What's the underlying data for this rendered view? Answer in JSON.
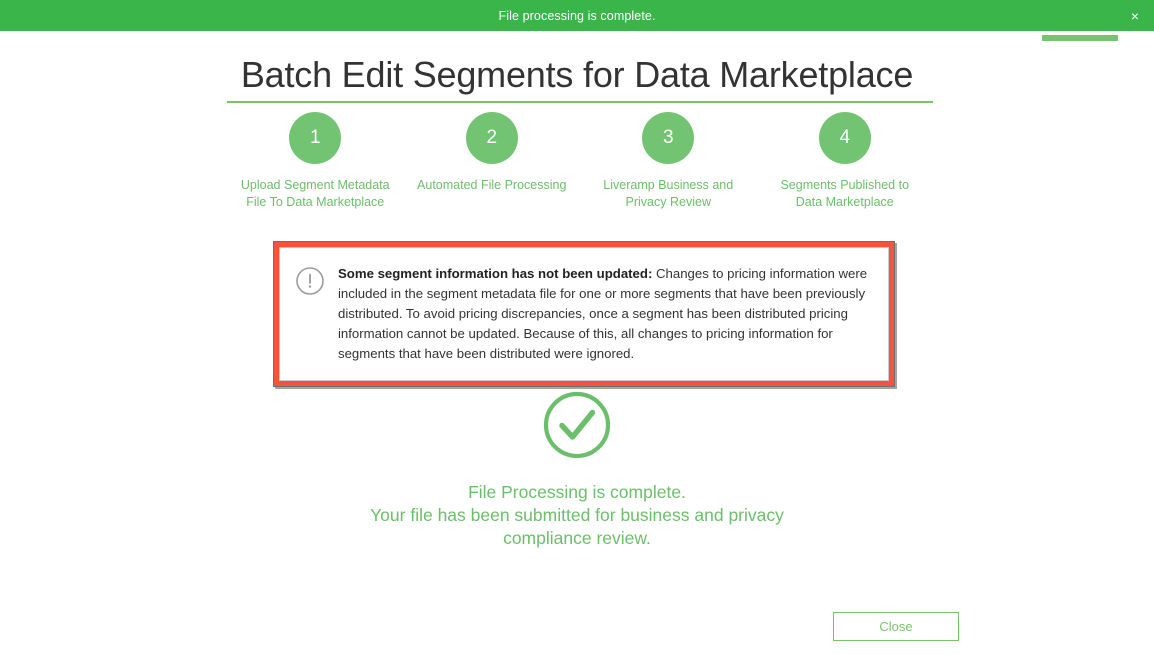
{
  "banner": {
    "message": "File processing is complete.",
    "close_icon": "close-icon",
    "close_label": "×",
    "background": "#39b54a"
  },
  "mini_progress": {
    "value": 100,
    "color": "#74c572"
  },
  "page": {
    "title": "Batch Edit Segments for Data Marketplace",
    "accent_color": "#7ac36c"
  },
  "stepper": {
    "steps": [
      {
        "number": "1",
        "label": "Upload Segment Metadata File To Data Marketplace"
      },
      {
        "number": "2",
        "label": "Automated File Processing"
      },
      {
        "number": "3",
        "label": "Liveramp Business and Privacy Review"
      },
      {
        "number": "4",
        "label": "Segments Published to Data Marketplace"
      }
    ]
  },
  "alert": {
    "icon": "exclamation-circle-icon",
    "border_color": "#f4543c",
    "title": "Some segment information has not been updated:",
    "message": " Changes to pricing information were included in the segment metadata file for one or more segments that have been previously distributed. To avoid pricing discrepancies, once a segment has been distributed pricing information cannot be updated. Because of this, all changes to pricing information for segments that have been distributed were ignored."
  },
  "success": {
    "icon": "check-circle-icon",
    "color": "#6cbf6a",
    "line1": "File Processing is complete.",
    "line2": "Your file has been submitted for business and privacy",
    "line3": "compliance review."
  },
  "footer": {
    "close_label": "Close"
  }
}
